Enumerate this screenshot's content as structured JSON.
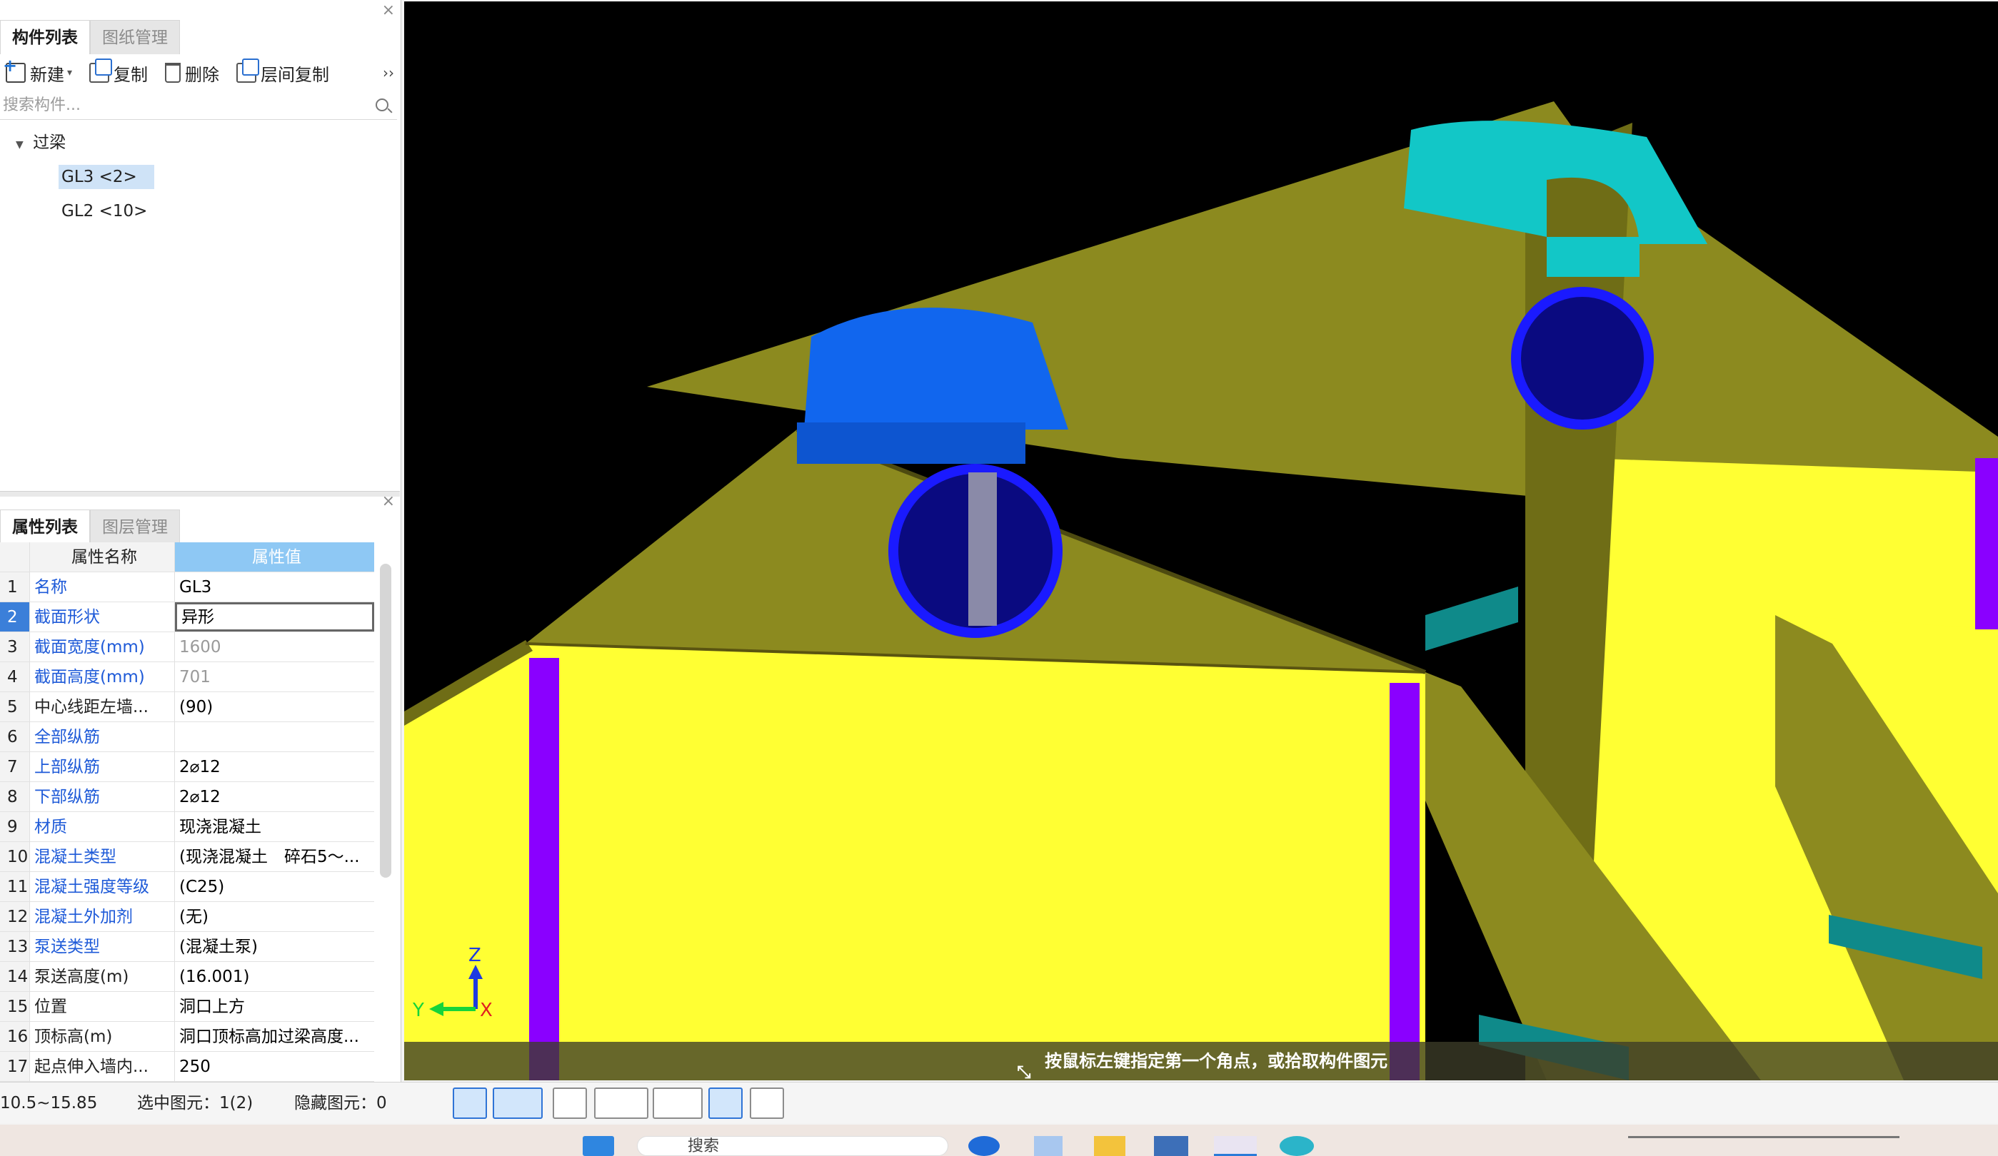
{
  "left_panel": {
    "tabs": [
      "构件列表",
      "图纸管理"
    ],
    "close_label": "×",
    "toolbar": {
      "new": "新建",
      "copy": "复制",
      "delete": "删除",
      "floor_copy": "层间复制",
      "more": "››"
    },
    "search_placeholder": "搜索构件...",
    "tree": {
      "root": "过梁",
      "children": [
        "GL3 <2>",
        "GL2 <10>"
      ],
      "selected_index": 0
    }
  },
  "property_panel": {
    "tabs": [
      "属性列表",
      "图层管理"
    ],
    "close_label": "×",
    "headers": {
      "name": "属性名称",
      "value": "属性值"
    },
    "rows": [
      {
        "no": "1",
        "name": "名称",
        "value": "GL3",
        "name_style": "blue"
      },
      {
        "no": "2",
        "name": "截面形状",
        "value": "异形",
        "name_style": "blue"
      },
      {
        "no": "3",
        "name": "截面宽度(mm)",
        "value": "1600",
        "name_style": "blue"
      },
      {
        "no": "4",
        "name": "截面高度(mm)",
        "value": "701",
        "name_style": "blue"
      },
      {
        "no": "5",
        "name": "中心线距左墙...",
        "value": "(90)",
        "name_style": "dark"
      },
      {
        "no": "6",
        "name": "全部纵筋",
        "value": "",
        "name_style": "blue"
      },
      {
        "no": "7",
        "name": "上部纵筋",
        "value": "2⌀12",
        "name_style": "blue"
      },
      {
        "no": "8",
        "name": "下部纵筋",
        "value": "2⌀12",
        "name_style": "blue"
      },
      {
        "no": "9",
        "name": "材质",
        "value": "现浇混凝土",
        "name_style": "blue"
      },
      {
        "no": "10",
        "name": "混凝土类型",
        "value": "(现浇混凝土　碎石5～...",
        "name_style": "blue"
      },
      {
        "no": "11",
        "name": "混凝土强度等级",
        "value": "(C25)",
        "name_style": "blue"
      },
      {
        "no": "12",
        "name": "混凝土外加剂",
        "value": "(无)",
        "name_style": "blue"
      },
      {
        "no": "13",
        "name": "泵送类型",
        "value": "(混凝土泵)",
        "name_style": "blue"
      },
      {
        "no": "14",
        "name": "泵送高度(m)",
        "value": "(16.001)",
        "name_style": "dark"
      },
      {
        "no": "15",
        "name": "位置",
        "value": "洞口上方",
        "name_style": "dark"
      },
      {
        "no": "16",
        "name": "顶标高(m)",
        "value": "洞口顶标高加过梁高度...",
        "name_style": "dark"
      },
      {
        "no": "17",
        "name": "起点伸入墙内...",
        "value": "250",
        "name_style": "dark"
      }
    ],
    "selected_row": 1
  },
  "viewport": {
    "hint": "按鼠标左键指定第一个角点，或拾取构件图元",
    "axis_labels": {
      "z": "Z",
      "y": "Y",
      "x": "X"
    },
    "colors": {
      "background": "#000000",
      "wall": "#ffff33",
      "roof": "#8c8a1f",
      "lintel_blue": "#1166ee",
      "lintel_teal": "#12c7c7",
      "column": "#8a00ff",
      "opening": "#0a0a80"
    }
  },
  "status_bar": {
    "range": "10.5~15.85",
    "selected": "选中图元：1(2)",
    "hidden": "隐藏图元：0"
  },
  "taskbar": {
    "search": "搜索"
  }
}
